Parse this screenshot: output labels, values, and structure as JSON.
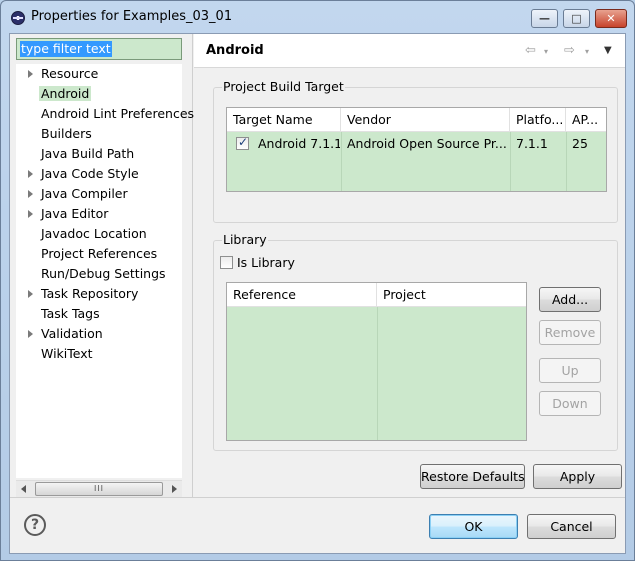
{
  "window": {
    "title": "Properties for Examples_03_01",
    "min_glyph": "—",
    "max_glyph": "□",
    "close_glyph": "✕"
  },
  "sidebar": {
    "filter_placeholder": "type filter text",
    "items": [
      {
        "label": "Resource",
        "expandable": true
      },
      {
        "label": "Android",
        "expandable": false,
        "selected": true
      },
      {
        "label": "Android Lint Preferences",
        "expandable": false
      },
      {
        "label": "Builders",
        "expandable": false
      },
      {
        "label": "Java Build Path",
        "expandable": false
      },
      {
        "label": "Java Code Style",
        "expandable": true
      },
      {
        "label": "Java Compiler",
        "expandable": true
      },
      {
        "label": "Java Editor",
        "expandable": true
      },
      {
        "label": "Javadoc Location",
        "expandable": false
      },
      {
        "label": "Project References",
        "expandable": false
      },
      {
        "label": "Run/Debug Settings",
        "expandable": false
      },
      {
        "label": "Task Repository",
        "expandable": true
      },
      {
        "label": "Task Tags",
        "expandable": false
      },
      {
        "label": "Validation",
        "expandable": true
      },
      {
        "label": "WikiText",
        "expandable": false
      }
    ],
    "scroll_grip": "III"
  },
  "page": {
    "title": "Android",
    "nav": {
      "back": "⇦",
      "forward": "⇨",
      "menu": "▾",
      "view_menu": "▼"
    }
  },
  "build_target": {
    "title": "Project Build Target",
    "columns": [
      "Target Name",
      "Vendor",
      "Platfo...",
      "AP..."
    ],
    "rows": [
      {
        "checked": true,
        "name": "Android 7.1.1",
        "vendor": "Android Open Source Pr...",
        "platform": "7.1.1",
        "api": "25"
      }
    ]
  },
  "library": {
    "title": "Library",
    "is_library_label": "Is Library",
    "is_library_checked": false,
    "columns": [
      "Reference",
      "Project"
    ],
    "buttons": {
      "add": "Add...",
      "remove": "Remove",
      "up": "Up",
      "down": "Down"
    }
  },
  "actions": {
    "restore_defaults": "Restore Defaults",
    "apply": "Apply"
  },
  "footer": {
    "help": "?",
    "ok": "OK",
    "cancel": "Cancel"
  }
}
